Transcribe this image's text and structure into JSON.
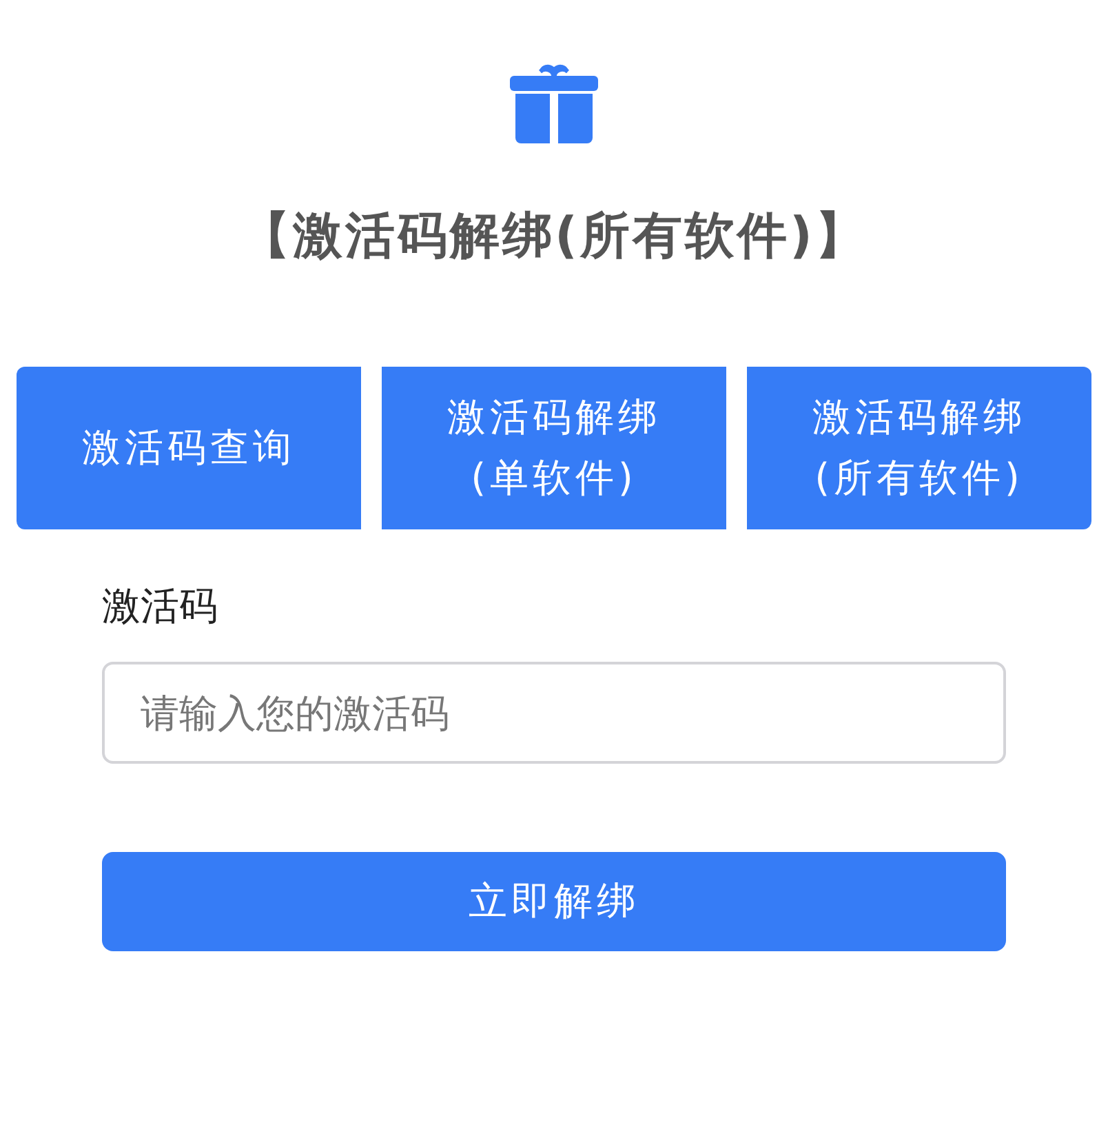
{
  "title": "【激活码解绑(所有软件)】",
  "tabs": [
    {
      "label": "激活码查询"
    },
    {
      "label": "激活码解绑\n(单软件)"
    },
    {
      "label": "激活码解绑\n(所有软件)"
    }
  ],
  "form": {
    "label": "激活码",
    "placeholder": "请输入您的激活码",
    "submit": "立即解绑"
  }
}
